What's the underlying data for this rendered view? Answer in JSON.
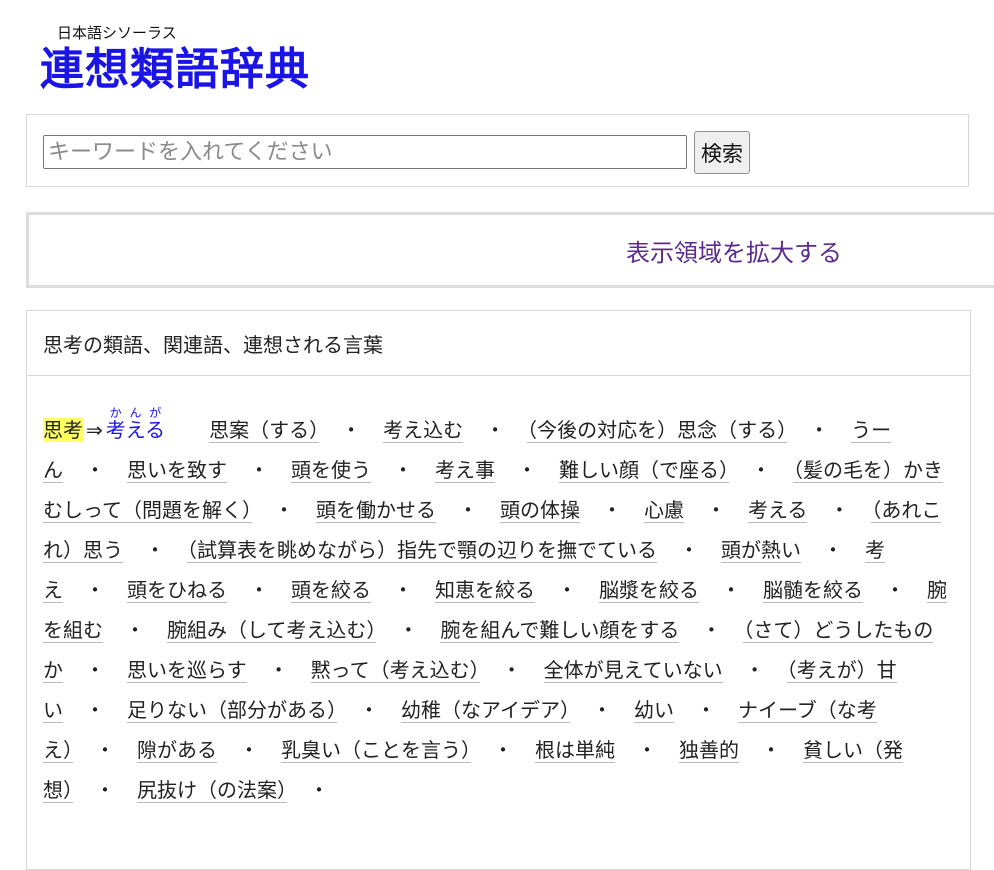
{
  "logo": {
    "subtitle": "日本語シソーラス",
    "title": "連想類語辞典"
  },
  "search": {
    "placeholder": "キーワードを入れてください",
    "button_label": "検索"
  },
  "expand": {
    "label": "表示領域を拡大する"
  },
  "results": {
    "header": "思考の類語、関連語、連想される言葉",
    "keyword": "思考",
    "arrow": "⇒",
    "main_word": "考える",
    "main_reading": "かんが",
    "terms": [
      "思案（する）",
      "考え込む",
      "（今後の対応を）思念（する）",
      "うーん",
      "思いを致す",
      "頭を使う",
      "考え事",
      "難しい顔（で座る）",
      "（髪の毛を）かきむしって（問題を解く）",
      "頭を働かせる",
      "頭の体操",
      "心慮",
      "考える",
      "（あれこれ）思う",
      "（試算表を眺めながら）指先で顎の辺りを撫でている",
      "頭が熱い",
      "考え",
      "頭をひねる",
      "頭を絞る",
      "知恵を絞る",
      "脳漿を絞る",
      "脳髄を絞る",
      "腕を組む",
      "腕組み（して考え込む）",
      "腕を組んで難しい顔をする",
      "（さて）どうしたものか",
      "思いを巡らす",
      "黙って（考え込む）",
      "全体が見えていない",
      "（考えが）甘い",
      "足りない（部分がある）",
      "幼稚（なアイデア）",
      "幼い",
      "ナイーブ（な考え）",
      "隙がある",
      "乳臭い（ことを言う）",
      "根は単純",
      "独善的",
      "貧しい（発想）",
      "尻抜け（の法案）"
    ],
    "separator": "・"
  }
}
